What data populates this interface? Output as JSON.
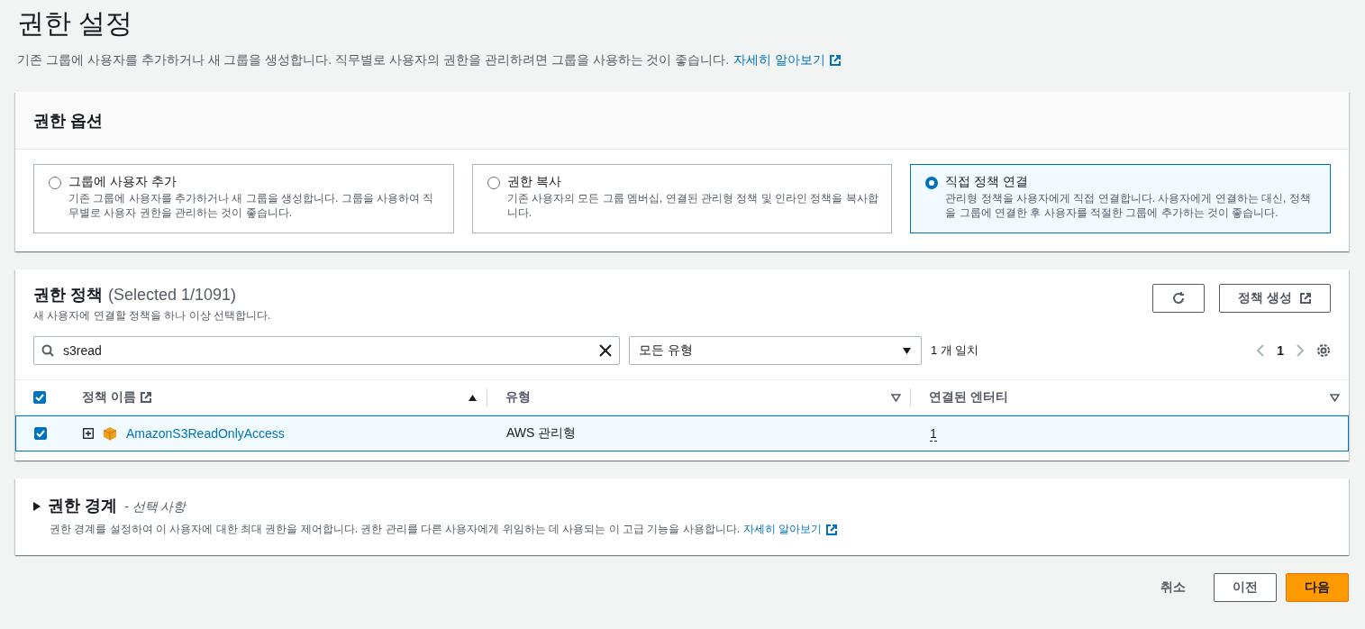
{
  "page": {
    "title": "권한 설정",
    "description": "기존 그룹에 사용자를 추가하거나 새 그룹을 생성합니다. 직무별로 사용자의 권한을 관리하려면 그룹을 사용하는 것이 좋습니다.",
    "link": "자세히 알아보기"
  },
  "options_panel": {
    "title": "권한 옵션",
    "options": [
      {
        "title": "그룹에 사용자 추가",
        "description": "기존 그룹에 사용자를 추가하거나 새 그룹을 생성합니다. 그룹을 사용하여 직무별로 사용자 권한을 관리하는 것이 좋습니다.",
        "selected": false
      },
      {
        "title": "권한 복사",
        "description": "기존 사용자의 모든 그룹 멤버십, 연결된 관리형 정책 및 인라인 정책을 복사합니다.",
        "selected": false
      },
      {
        "title": "직접 정책 연결",
        "description": "관리형 정책을 사용자에게 직접 연결합니다. 사용자에게 연결하는 대신, 정책을 그룹에 연결한 후 사용자를 적절한 그룹에 추가하는 것이 좋습니다.",
        "selected": true
      }
    ]
  },
  "policies_panel": {
    "title": "권한 정책",
    "count": "(Selected 1/1091)",
    "subtitle": "새 사용자에 연결할 정책을 하나 이상 선택합니다.",
    "create_button": "정책 생성",
    "search": "s3read",
    "type_filter": "모든 유형",
    "match_count": "1 개 일치",
    "page": "1",
    "all_checked": true,
    "columns": [
      {
        "label": "정책 이름",
        "sorted": true,
        "external": true
      },
      {
        "label": "유형",
        "sorted": false,
        "external": false
      },
      {
        "label": "연결된 엔터티",
        "sorted": false,
        "external": false
      }
    ],
    "rows": [
      {
        "checked": true,
        "name": "AmazonS3ReadOnlyAccess",
        "type": "AWS 관리형",
        "entities": "1"
      }
    ]
  },
  "boundary_panel": {
    "title": "권한 경계",
    "optional": "- 선택 사항",
    "expanded": false,
    "description": "권한 경계를 설정하여 이 사용자에 대한 최대 권한을 제어합니다. 권한 관리를 다른 사용자에게 위임하는 데 사용되는 이 고급 기능을 사용합니다.",
    "link": "자세히 알아보기"
  },
  "footer": {
    "cancel": "취소",
    "previous": "이전",
    "next": "다음"
  }
}
